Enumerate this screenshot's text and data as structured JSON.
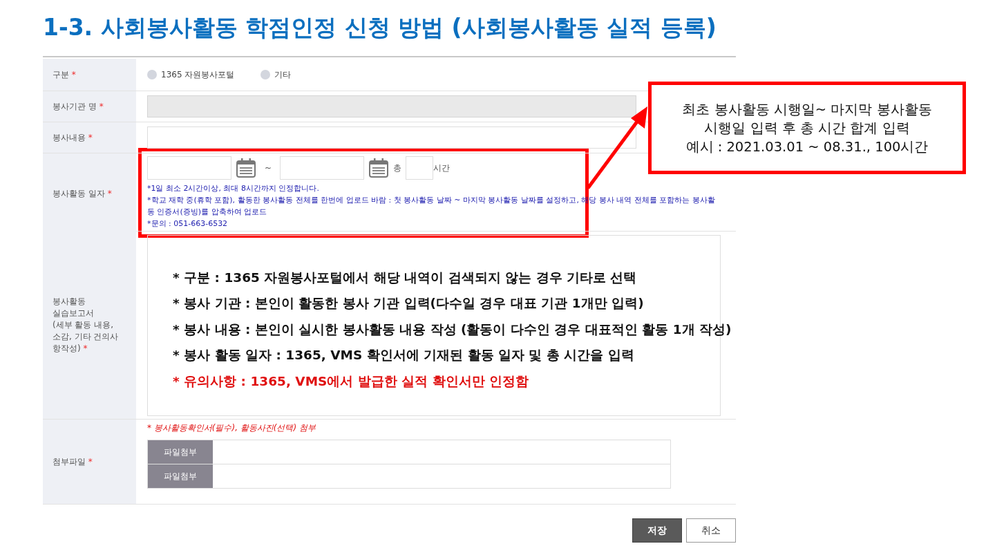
{
  "title": "1-3. 사회봉사활동 학점인정 신청 방법 (사회봉사활동 실적 등록)",
  "form": {
    "rows": [
      {
        "kind": "radio",
        "label_lines": [
          "구분"
        ],
        "required_mark": "*",
        "options": [
          {
            "label": "1365 자원봉사포털",
            "selected": false
          },
          {
            "label": "기타",
            "selected": false
          }
        ]
      },
      {
        "kind": "text",
        "label_lines": [
          "봉사기관 명"
        ],
        "required_mark": "*",
        "disabled": true
      },
      {
        "kind": "text",
        "label_lines": [
          "봉사내용"
        ],
        "required_mark": "*",
        "disabled": false
      },
      {
        "kind": "dates",
        "label_lines": [
          "봉사활동 일자"
        ],
        "required_mark": "*",
        "separator": "~",
        "total_label": "총",
        "unit": "시간",
        "notes": [
          "*1일 최소 2시간이상, 최대 8시간까지 인정합니다.",
          "*학교 재학 중(휴학 포함), 활동한 봉사활동 전체를 한번에 업로드 바람 : 첫 봉사활동 날짜 ~ 마지막 봉사활동 날짜를 설정하고, 해당 봉사 내역 전체를 포함하는 봉사활동 인증서(증빙)를 압축하여 업로드",
          "*문의 : 051-663-6532"
        ]
      },
      {
        "kind": "textarea",
        "label_lines": [
          "봉사활동",
          "실습보고서",
          "(세부 활동 내용,",
          "소감, 기타 건의사",
          "항작성)"
        ],
        "required_mark": "*",
        "lines": [
          {
            "bullet": "*",
            "text": "구분 : 1365 자원봉사포털에서 해당 내역이 검색되지 않는 경우 기타로 선택",
            "kind": "normal"
          },
          {
            "bullet": "*",
            "text": "봉사 기관 : 본인이 활동한 봉사 기관 입력(다수일 경우 대표 기관 1개만 입력)",
            "kind": "normal"
          },
          {
            "bullet": "*",
            "text": "봉사 내용 : 본인이 실시한 봉사활동 내용 작성 (활동이 다수인 경우 대표적인 활동 1개 작성)",
            "kind": "normal"
          },
          {
            "bullet": "*",
            "text": "봉사 활동 일자 : 1365, VMS 확인서에 기재된 활동 일자 및 총 시간을 입력",
            "kind": "normal"
          },
          {
            "bullet": "*",
            "text": "유의사항 : 1365, VMS에서 발급한 실적 확인서만 인정함",
            "kind": "warning"
          }
        ]
      },
      {
        "kind": "files",
        "label_lines": [
          "첨부파일"
        ],
        "required_mark": "*",
        "note": "* 봉사활동확인서(필수), 활동사진(선택) 첨부",
        "buttons": [
          "파일첨부",
          "파일첨부"
        ]
      }
    ]
  },
  "buttons": [
    {
      "label": "저장",
      "kind": "primary"
    },
    {
      "label": "취소",
      "kind": "secondary"
    }
  ],
  "callout": {
    "lines": [
      "최초 봉사활동 시행일~ 마지막 봉사활동",
      "시행일 입력 후 총 시간 합계 입력",
      "예시 : 2021.03.01 ~ 08.31., 100시간"
    ]
  }
}
